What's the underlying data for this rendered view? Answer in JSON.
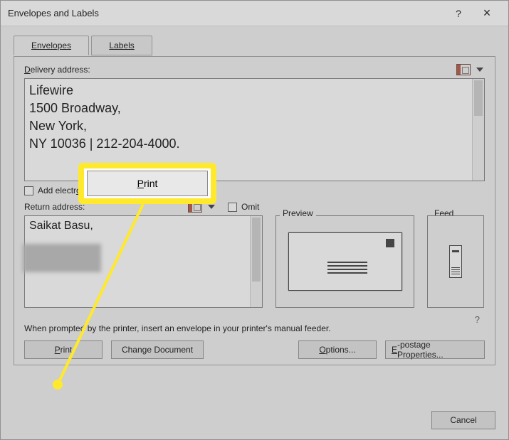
{
  "dialog": {
    "title": "Envelopes and Labels",
    "help": "?",
    "close": "×"
  },
  "tabs": {
    "envelopes": "Envelopes",
    "labels": "Labels"
  },
  "deliveryLabel": "Delivery address:",
  "deliveryAddress": "Lifewire\n1500 Broadway,\nNew York, \nNY 10036 | 212-204-4000.",
  "addPostage": "Add electronic postage",
  "returnLabel": "Return address:",
  "omit": "Omit",
  "returnAddress": "Saikat Basu,",
  "previewLabel": "Preview",
  "feedLabel": "Feed",
  "hint": "When prompted by the printer, insert an envelope in your printer's manual feeder.",
  "buttons": {
    "print": "Print",
    "change": "Change Document",
    "options": "Options...",
    "epostage": "E-postage Properties...",
    "cancel": "Cancel"
  },
  "callout": {
    "print": "Print"
  }
}
